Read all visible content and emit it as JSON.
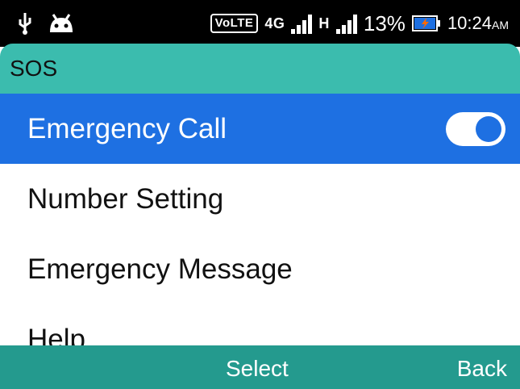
{
  "status_bar": {
    "volte": "VoLTE",
    "net1": "4G",
    "net2": "H",
    "battery": "13%",
    "time": "10:24",
    "ampm": "AM",
    "icons": [
      "usb-icon",
      "android-icon",
      "signal-icon",
      "battery-charging-icon"
    ]
  },
  "title": "SOS",
  "menu": {
    "items": [
      {
        "label": "Emergency Call",
        "selected": true,
        "toggle": "on"
      },
      {
        "label": "Number Setting"
      },
      {
        "label": "Emergency Message"
      },
      {
        "label": "Help"
      }
    ]
  },
  "softkeys": {
    "center": "Select",
    "right": "Back"
  },
  "colors": {
    "title_bar": "#3bbcae",
    "selection": "#1e70e2",
    "softkey_bar": "#249a8e",
    "status_bar": "#000000"
  }
}
